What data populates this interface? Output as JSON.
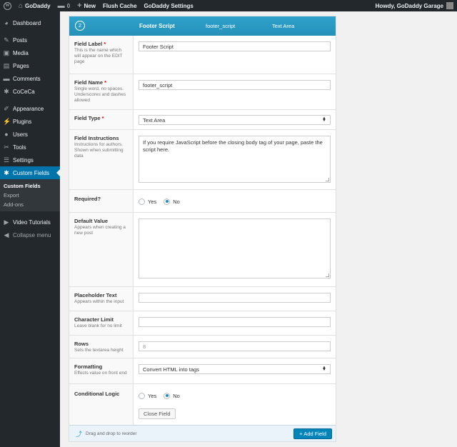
{
  "adminbar": {
    "site_name": "GoDaddy",
    "comments_count": "0",
    "new_label": "New",
    "flush_cache": "Flush Cache",
    "godaddy_settings": "GoDaddy Settings",
    "howdy": "Howdy, GoDaddy Garage"
  },
  "sidebar": {
    "items": [
      {
        "label": "Dashboard",
        "icon": "dashboard-icon"
      },
      {
        "label": "Posts",
        "icon": "pin-icon"
      },
      {
        "label": "Media",
        "icon": "media-icon"
      },
      {
        "label": "Pages",
        "icon": "page-icon"
      },
      {
        "label": "Comments",
        "icon": "comment-icon"
      },
      {
        "label": "CoCeCa",
        "icon": "gear-icon"
      },
      {
        "label": "Appearance",
        "icon": "brush-icon"
      },
      {
        "label": "Plugins",
        "icon": "plugin-icon"
      },
      {
        "label": "Users",
        "icon": "user-icon"
      },
      {
        "label": "Tools",
        "icon": "wrench-icon"
      },
      {
        "label": "Settings",
        "icon": "settings-icon"
      },
      {
        "label": "Custom Fields",
        "icon": "gear-icon"
      }
    ],
    "submenu": [
      "Custom Fields",
      "Export",
      "Add-ons"
    ],
    "video_tutorials": "Video Tutorials",
    "collapse": "Collapse menu"
  },
  "field_header": {
    "order": "2",
    "label": "Footer Script",
    "name": "footer_script",
    "type": "Text Area"
  },
  "fields": {
    "label": {
      "title": "Field Label",
      "required": "*",
      "desc": "This is the name which will appear on the EDIT page",
      "value": "Footer Script"
    },
    "name": {
      "title": "Field Name",
      "required": "*",
      "desc": "Single word, no spaces. Underscores and dashes allowed",
      "value": "footer_script"
    },
    "type": {
      "title": "Field Type",
      "required": "*",
      "value": "Text Area"
    },
    "instructions": {
      "title": "Field Instructions",
      "desc": "Instructions for authors. Shown when submitting data",
      "value": "If you require JavaScript before the closing body tag of your page, paste the script here."
    },
    "required": {
      "title": "Required?",
      "yes": "Yes",
      "no": "No",
      "selected": "No"
    },
    "default_value": {
      "title": "Default Value",
      "desc": "Appears when creating a new post",
      "value": ""
    },
    "placeholder": {
      "title": "Placeholder Text",
      "desc": "Appears within the input",
      "value": ""
    },
    "char_limit": {
      "title": "Character Limit",
      "desc": "Leave blank for no limit",
      "value": ""
    },
    "rows": {
      "title": "Rows",
      "desc": "Sets the textarea height",
      "placeholder": "8"
    },
    "formatting": {
      "title": "Formatting",
      "desc": "Effects value on front end",
      "value": "Convert HTML into tags"
    },
    "conditional": {
      "title": "Conditional Logic",
      "yes": "Yes",
      "no": "No",
      "selected": "No"
    }
  },
  "close_field": "Close Field",
  "footer": {
    "hint": "Drag and drop to reorder",
    "add_field": "+ Add Field"
  }
}
